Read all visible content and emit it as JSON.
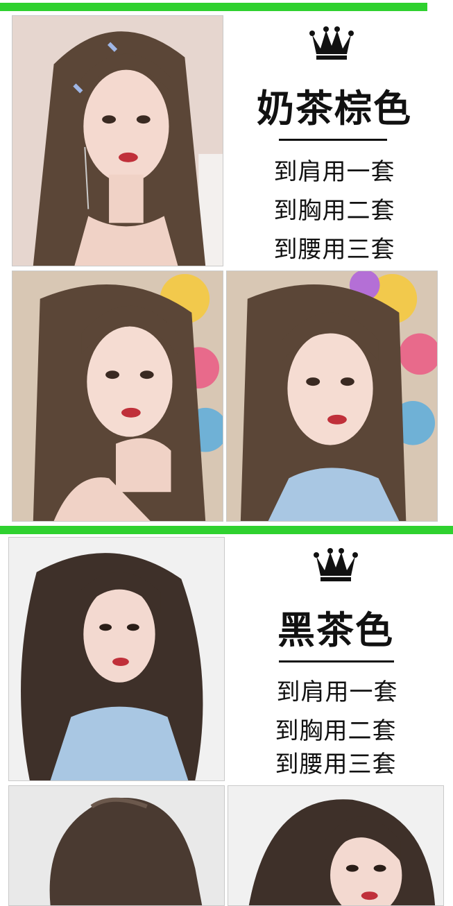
{
  "sections": [
    {
      "crown_icon": "crown-icon",
      "title": "奶茶棕色",
      "options": [
        "到肩用一套",
        "到胸用二套",
        "到腰用三套"
      ],
      "hair_color": "#5b4637"
    },
    {
      "crown_icon": "crown-icon",
      "title": "黑茶色",
      "options": [
        "到肩用一套",
        "到胸用二套",
        "到腰用三套"
      ],
      "hair_color": "#3e3029"
    }
  ],
  "colors": {
    "accent_bar": "#2fd12f",
    "text": "#111111"
  }
}
